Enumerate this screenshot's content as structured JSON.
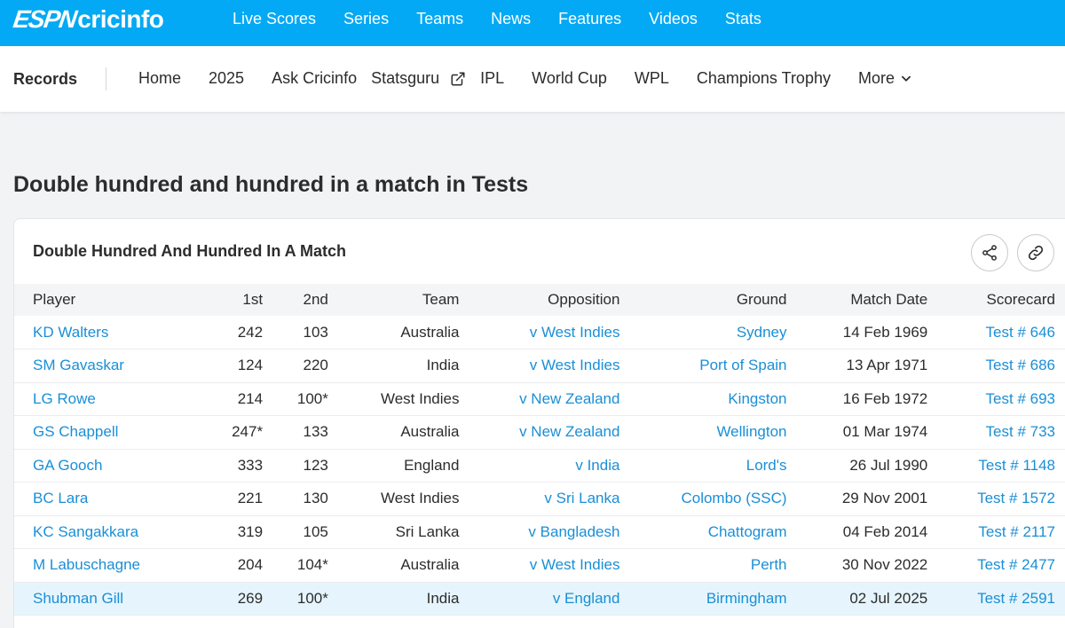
{
  "logo": {
    "espn": "ESPN",
    "cric": "cricinfo"
  },
  "topnav": [
    "Live Scores",
    "Series",
    "Teams",
    "News",
    "Features",
    "Videos",
    "Stats"
  ],
  "subnav": {
    "brand": "Records",
    "items": [
      "Home",
      "2025",
      "Ask Cricinfo",
      "Statsguru",
      "IPL",
      "World Cup",
      "WPL",
      "Champions Trophy",
      "More"
    ]
  },
  "page_title": "Double hundred and hundred in a match in Tests",
  "card": {
    "title": "Double Hundred And Hundred In A Match",
    "share_icon": "share-icon",
    "link_icon": "link-icon"
  },
  "table": {
    "headers": [
      "Player",
      "1st",
      "2nd",
      "Team",
      "Opposition",
      "Ground",
      "Match Date",
      "Scorecard"
    ],
    "rows": [
      [
        "KD Walters",
        "242",
        "103",
        "Australia",
        "v West Indies",
        "Sydney",
        "14 Feb 1969",
        "Test # 646"
      ],
      [
        "SM Gavaskar",
        "124",
        "220",
        "India",
        "v West Indies",
        "Port of Spain",
        "13 Apr 1971",
        "Test # 686"
      ],
      [
        "LG Rowe",
        "214",
        "100*",
        "West Indies",
        "v New Zealand",
        "Kingston",
        "16 Feb 1972",
        "Test # 693"
      ],
      [
        "GS Chappell",
        "247*",
        "133",
        "Australia",
        "v New Zealand",
        "Wellington",
        "01 Mar 1974",
        "Test # 733"
      ],
      [
        "GA Gooch",
        "333",
        "123",
        "England",
        "v India",
        "Lord's",
        "26 Jul 1990",
        "Test # 1148"
      ],
      [
        "BC Lara",
        "221",
        "130",
        "West Indies",
        "v Sri Lanka",
        "Colombo (SSC)",
        "29 Nov 2001",
        "Test # 1572"
      ],
      [
        "KC Sangakkara",
        "319",
        "105",
        "Sri Lanka",
        "v Bangladesh",
        "Chattogram",
        "04 Feb 2014",
        "Test # 2117"
      ],
      [
        "M Labuschagne",
        "204",
        "104*",
        "Australia",
        "v West Indies",
        "Perth",
        "30 Nov 2022",
        "Test # 2477"
      ],
      [
        "Shubman Gill",
        "269",
        "100*",
        "India",
        "v England",
        "Birmingham",
        "02 Jul 2025",
        "Test # 2591"
      ]
    ],
    "highlight_row": 8
  },
  "colors": {
    "brand_blue": "#03a9f4",
    "link_blue": "#1a8fd6",
    "highlight": "#e6f5fd"
  }
}
